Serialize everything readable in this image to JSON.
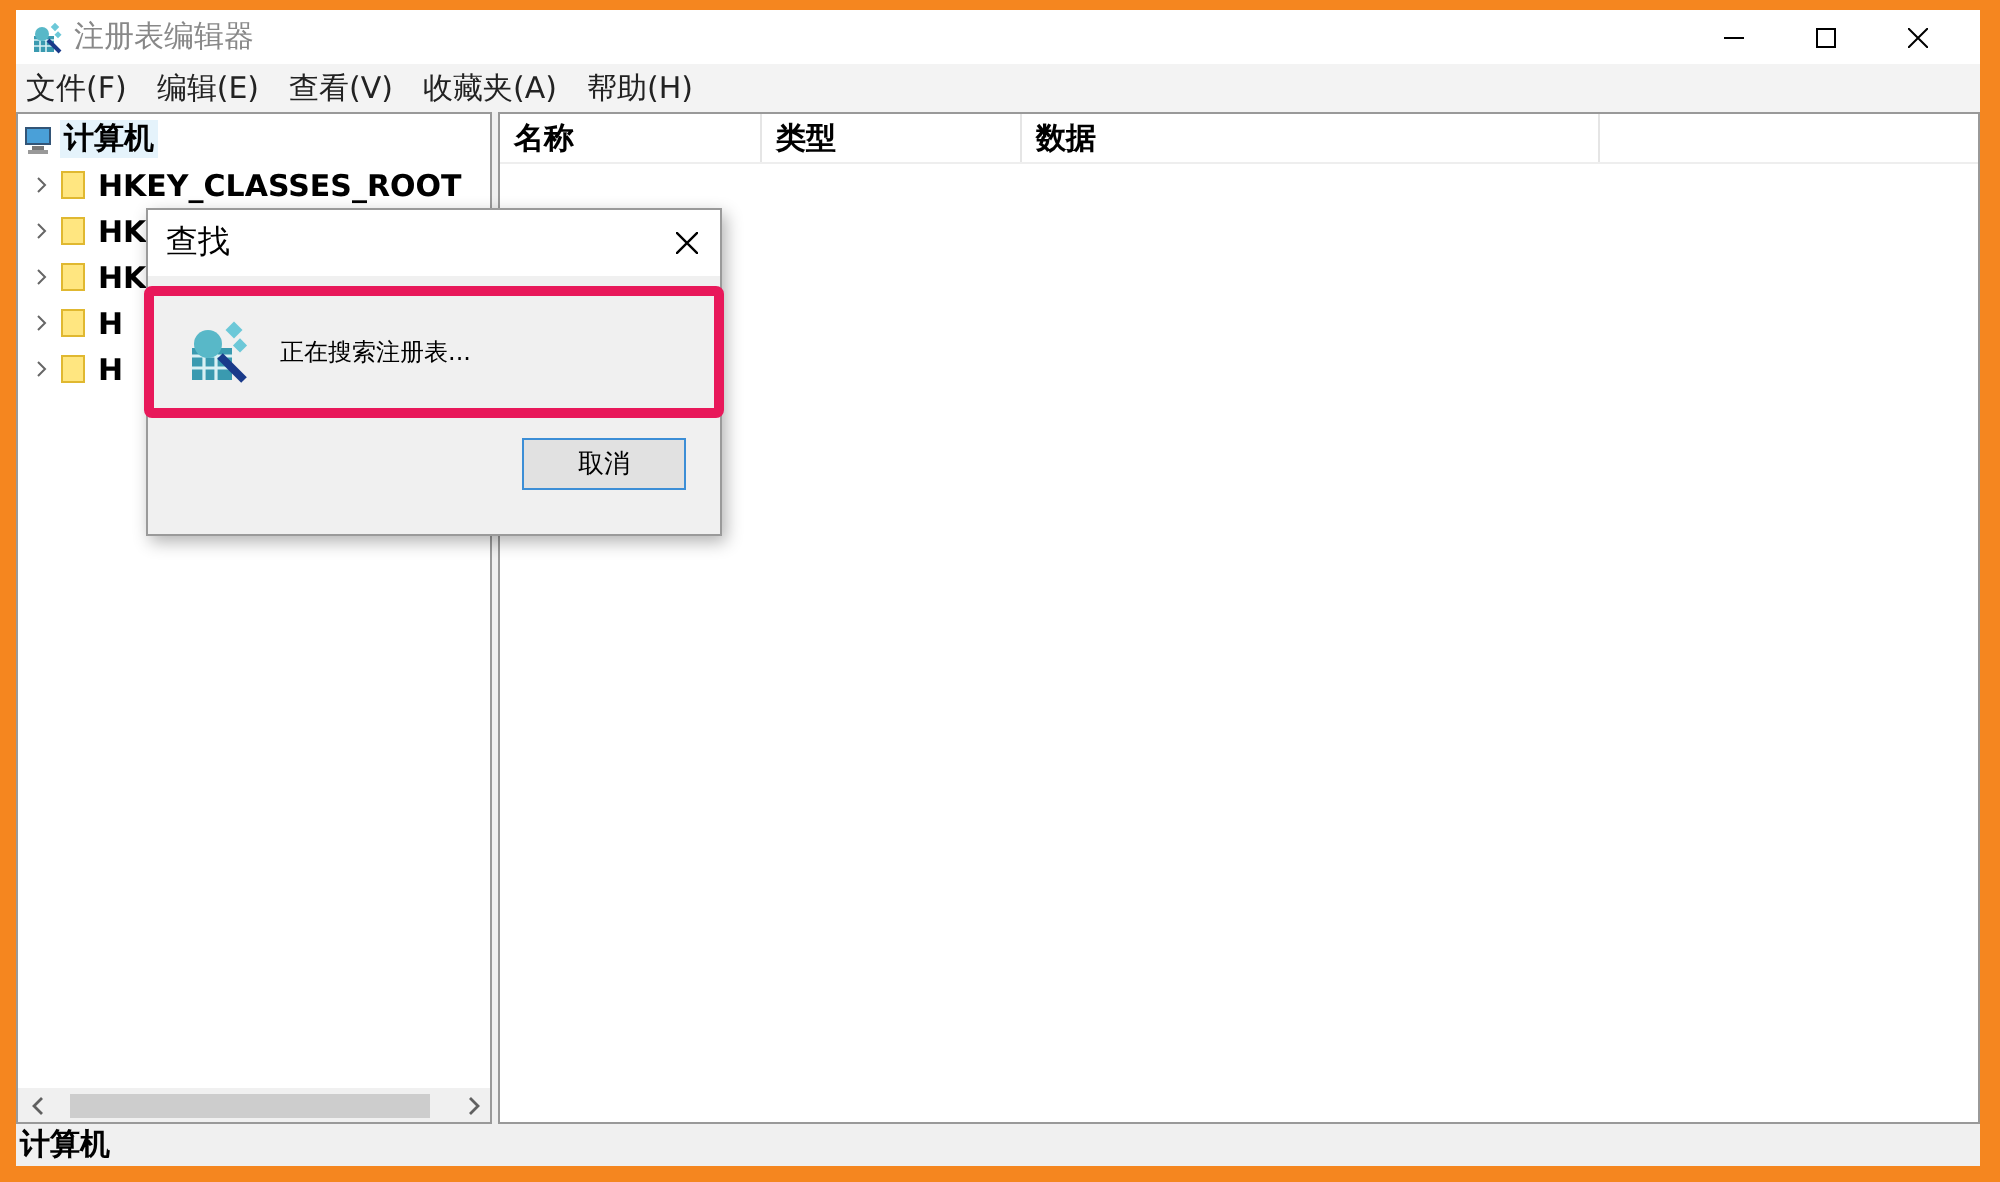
{
  "window": {
    "title": "注册表编辑器"
  },
  "menu": [
    "文件(F)",
    "编辑(E)",
    "查看(V)",
    "收藏夹(A)",
    "帮助(H)"
  ],
  "tree": {
    "label": "计算机",
    "selected": true,
    "children": [
      {
        "label": "HKEY_CLASSES_ROOT",
        "selected": false,
        "expanded": false
      },
      {
        "label": "HK",
        "selected": false,
        "expanded": false
      },
      {
        "label": "HK",
        "selected": false,
        "expanded": false
      },
      {
        "label": "H",
        "selected": false,
        "expanded": false
      },
      {
        "label": "H",
        "selected": false,
        "expanded": false
      }
    ]
  },
  "list": {
    "columns": [
      "名称",
      "类型",
      "数据"
    ]
  },
  "dialog": {
    "title": "查找",
    "message": "正在搜索注册表...",
    "message_highlighted": true,
    "buttons": [
      "取消"
    ]
  },
  "status_bar": "计算机"
}
